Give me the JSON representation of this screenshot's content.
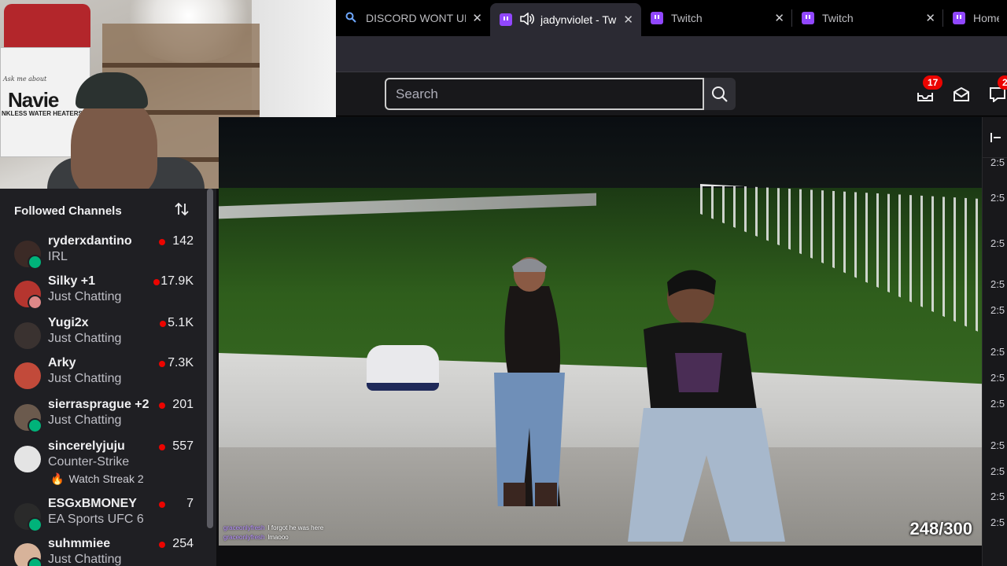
{
  "browser": {
    "tabs": [
      {
        "label": "DISCORD WONT UPD",
        "icon": "search-icon"
      },
      {
        "label": "jadynviolet - Twi",
        "icon": "twitch-icon",
        "audio": true,
        "active": true
      },
      {
        "label": "Twitch",
        "icon": "twitch-icon"
      },
      {
        "label": "Twitch",
        "icon": "twitch-icon"
      },
      {
        "label": "Home -",
        "icon": "twitch-icon"
      }
    ],
    "close_glyph": "✕"
  },
  "webcam": {
    "box_text": "Navie",
    "box_sub": "NKLESS WATER HEATERS",
    "box_ask": "Ask me about"
  },
  "topnav": {
    "search_placeholder": "Search",
    "notifications_count": "17",
    "whispers_count": "2"
  },
  "sidebar": {
    "title": "Followed Channels",
    "channels": [
      {
        "name": "ryderxdantino",
        "category": "IRL",
        "viewers": "142",
        "avatar_color": "#3b2a26"
      },
      {
        "name": "Silky +1",
        "category": "Just Chatting",
        "viewers": "17.9K",
        "avatar_color": "#b5352f"
      },
      {
        "name": "Yugi2x",
        "category": "Just Chatting",
        "viewers": "5.1K",
        "avatar_color": "#3a3230"
      },
      {
        "name": "Arky",
        "category": "Just Chatting",
        "viewers": "7.3K",
        "avatar_color": "#c24a3a"
      },
      {
        "name": "sierrasprague +2",
        "category": "Just Chatting",
        "viewers": "201",
        "avatar_color": "#6b5a4d"
      },
      {
        "name": "sincerelyjuju",
        "category": "Counter-Strike",
        "viewers": "557",
        "avatar_color": "#e4e4e4",
        "streak": "Watch Streak 2"
      },
      {
        "name": "ESGxBMONEY",
        "category": "EA Sports UFC 6",
        "viewers": "7",
        "avatar_color": "#2a2a2a"
      },
      {
        "name": "suhmmiee",
        "category": "Just Chatting",
        "viewers": "254",
        "avatar_color": "#d7b39a"
      }
    ]
  },
  "video": {
    "counter": "248/300",
    "chat": [
      {
        "user": "graceonlyfresh",
        "text": "I forgot he was here"
      },
      {
        "user": "graceonlyfresh",
        "text": "lmaooo"
      }
    ]
  },
  "chat_timestamps": [
    "2:5",
    "2:5",
    "2:5",
    "2:5",
    "2:5",
    "2:5",
    "2:5",
    "2:5",
    "2:5",
    "2:5",
    "2:5",
    "2:5",
    "2:5",
    "2:5"
  ]
}
